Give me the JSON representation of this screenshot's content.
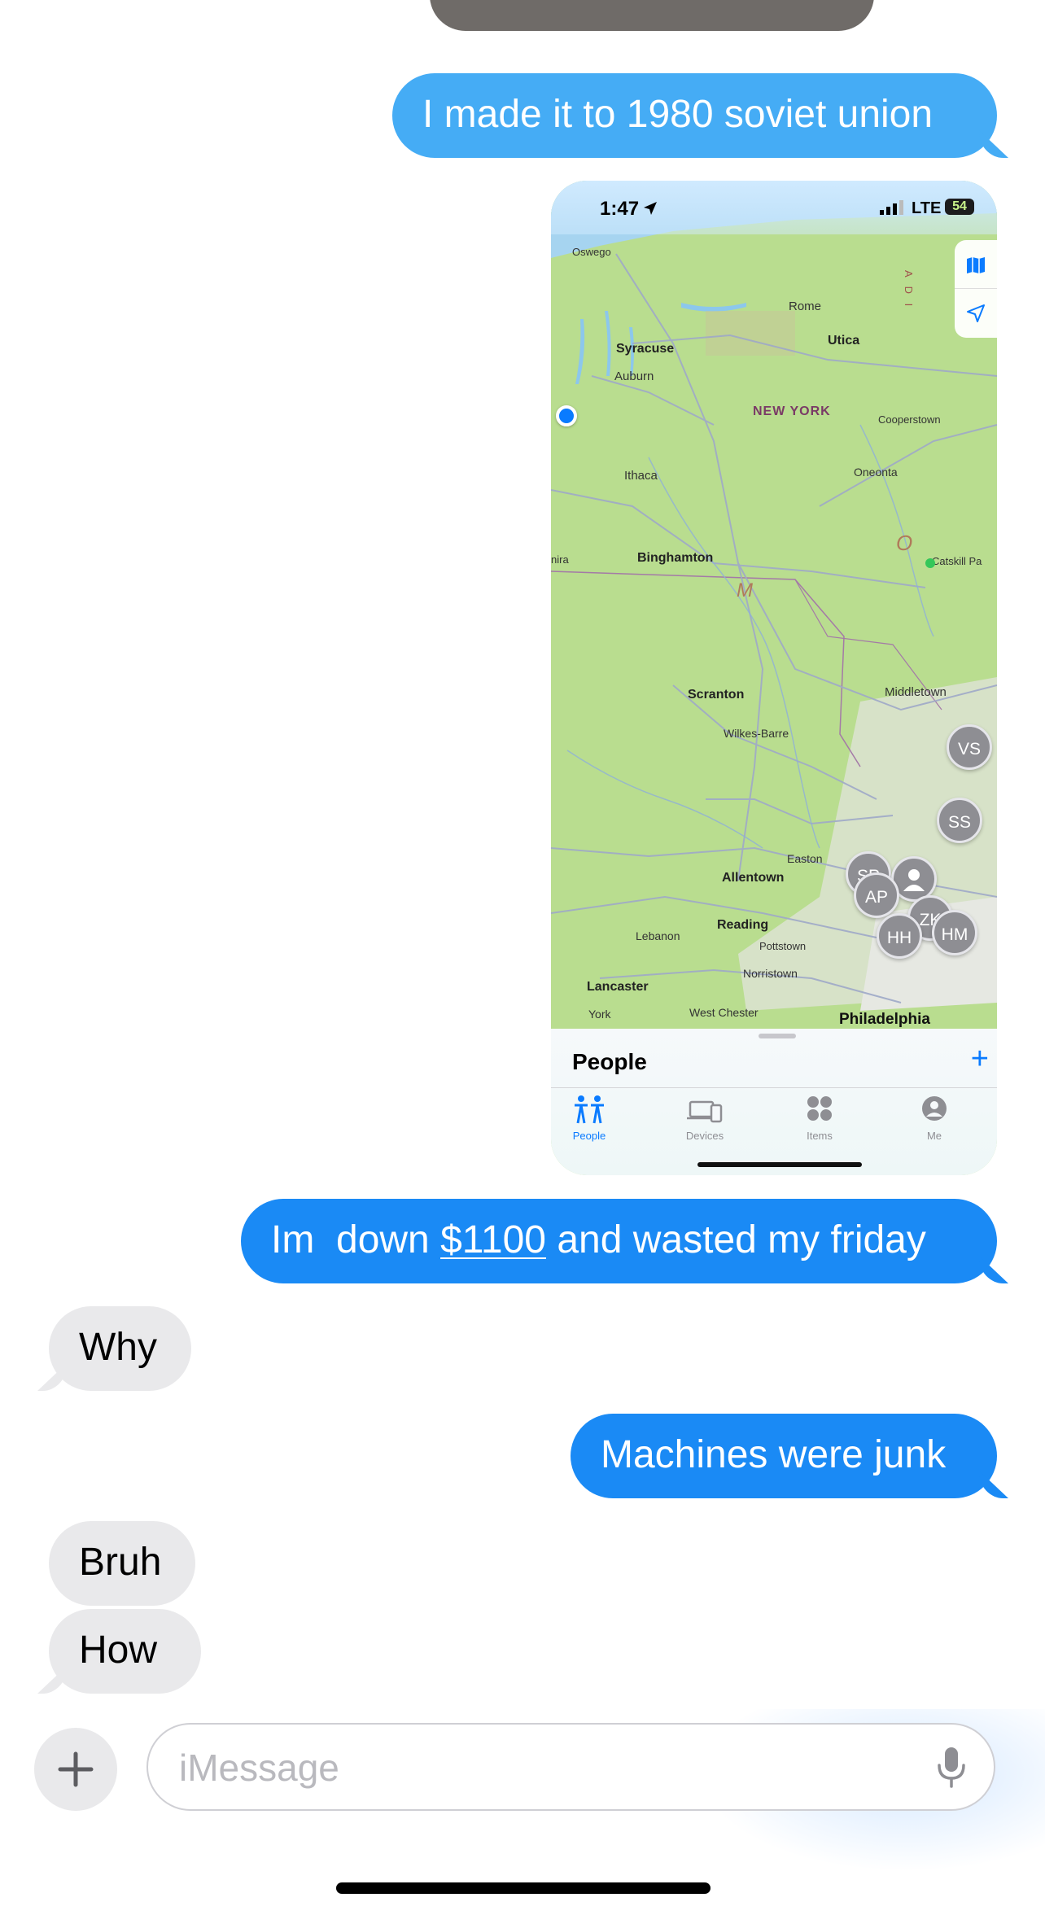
{
  "messages": [
    {
      "dir": "out",
      "text": "I made it to 1980 soviet union"
    },
    {
      "dir": "out",
      "text_pre": "Im  down ",
      "link": "$1100",
      "text_post": " and wasted my friday"
    },
    {
      "dir": "in",
      "text": "Why"
    },
    {
      "dir": "out",
      "text": "Machines were junk"
    },
    {
      "dir": "in",
      "text": "Bruh"
    },
    {
      "dir": "in",
      "text": "How"
    }
  ],
  "screenshot": {
    "status": {
      "time": "1:47",
      "network": "LTE",
      "battery": "54"
    },
    "map_labels": {
      "oswego": "Oswego",
      "rome": "Rome",
      "syracuse": "Syracuse",
      "utica": "Utica",
      "auburn": "Auburn",
      "new_york": "NEW YORK",
      "cooperstown": "Cooperstown",
      "ithaca": "Ithaca",
      "oneonta": "Oneonta",
      "catskill": "Catskill Pa",
      "elmira": "nira",
      "binghamton": "Binghamton",
      "scranton": "Scranton",
      "middletown": "Middletown",
      "wilkes_barre": "Wilkes-Barre",
      "easton": "Easton",
      "allentown": "Allentown",
      "reading": "Reading",
      "lebanon": "Lebanon",
      "pottstown": "Pottstown",
      "norristown": "Norristown",
      "lancaster": "Lancaster",
      "york": "York",
      "west_chester": "West Chester",
      "philadelphia": "Philadelphia",
      "edge_letters": "A D I",
      "o_letter": "O",
      "m_letter": "M"
    },
    "pins": [
      "VS",
      "SS",
      "SP",
      "AP",
      "ZK",
      "HH",
      "HM"
    ],
    "sheet_title": "People",
    "tabs": [
      "People",
      "Devices",
      "Items",
      "Me"
    ],
    "active_tab": "People",
    "accent": "#0a7bff"
  },
  "compose": {
    "placeholder": "iMessage"
  },
  "colors": {
    "outgoing": "#1a8af5",
    "incoming": "#e9e9eb"
  }
}
